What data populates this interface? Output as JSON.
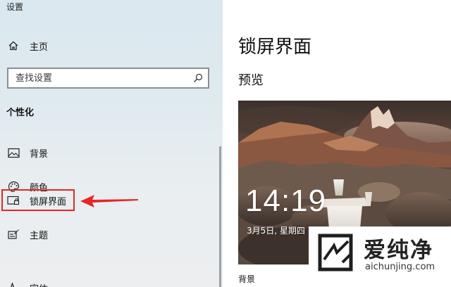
{
  "window": {
    "title": "设置"
  },
  "sidebar": {
    "home_label": "主页",
    "search": {
      "placeholder": "查找设置",
      "value": ""
    },
    "section_heading": "个性化",
    "items": [
      {
        "label": "背景",
        "icon": "picture-icon"
      },
      {
        "label": "颜色",
        "icon": "palette-icon"
      },
      {
        "label": "锁屏界面",
        "icon": "lock-screen-icon",
        "selected": true
      },
      {
        "label": "主题",
        "icon": "theme-icon"
      },
      {
        "label": "字体",
        "icon": "font-icon"
      }
    ]
  },
  "main": {
    "page_title": "锁屏界面",
    "preview_heading": "预览",
    "preview": {
      "time": "14:19",
      "date": "3月5日, 星期四"
    },
    "background_label": "背景"
  },
  "annotation": {
    "highlight_color": "#e52527",
    "arrow_color": "#e52527"
  },
  "watermark": {
    "title": "爱纯净",
    "url": "aichunjing.com"
  }
}
